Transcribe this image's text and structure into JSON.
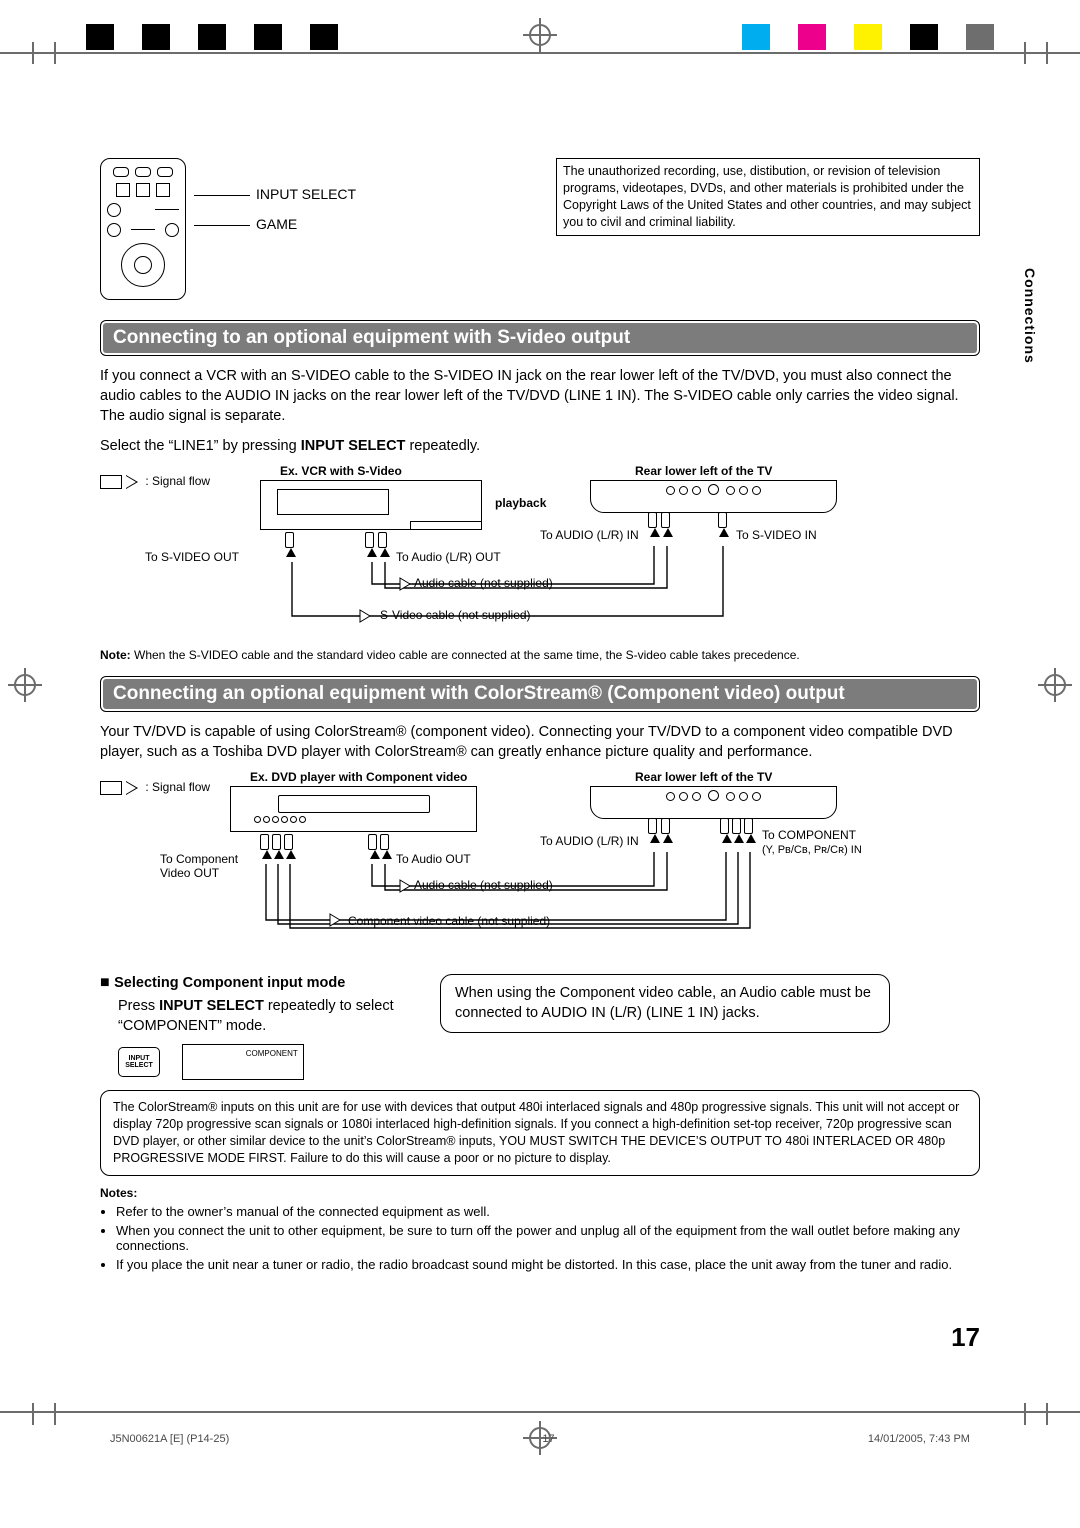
{
  "side_tab": "Connections",
  "remote": {
    "label_input": "INPUT SELECT",
    "label_game": "GAME"
  },
  "copyright_notice": "The unauthorized recording, use, distibution, or revision of television programs, videotapes, DVDs, and other materials is prohibited under the Copyright Laws of the United States and other countries, and may subject you to civil and criminal liability.",
  "section1": {
    "title": "Connecting to an optional equipment with S-video output",
    "body": "If you connect a VCR with an S-VIDEO cable to the S-VIDEO IN jack on the rear lower left of the TV/DVD, you must also connect the audio cables to the AUDIO IN jacks on the rear lower left of the TV/DVD (LINE 1 IN). The S-VIDEO cable only carries the video signal. The audio signal is separate.",
    "select_line": "Select the “LINE1” by pressing ",
    "select_bold": "INPUT SELECT",
    "select_tail": " repeatedly.",
    "signal_flow_label": ": Signal flow",
    "ex_label": "Ex.  VCR with S-Video",
    "playback": "playback",
    "rear_label": "Rear lower left of the TV",
    "to_svideo_out": "To S-VIDEO OUT",
    "to_audio_out": "To Audio (L/R) OUT",
    "to_audio_in": "To AUDIO (L/R) IN",
    "to_svideo_in": "To S-VIDEO IN",
    "audio_cable": "Audio cable (not supplied)",
    "svideo_cable": "S-Video cable (not supplied)",
    "note_bold": "Note:",
    "note": " When the S-VIDEO cable and the standard video cable are connected at the same time, the S-video cable takes precedence."
  },
  "section2": {
    "title": "Connecting an optional equipment with ColorStream® (Component video) output",
    "body": "Your TV/DVD is capable of using ColorStream® (component video). Connecting your TV/DVD to a component video compatible DVD player, such as a Toshiba DVD player with ColorStream® can greatly enhance picture quality and performance.",
    "signal_flow_label": ": Signal flow",
    "ex_label": "Ex. DVD player with Component video",
    "rear_label": "Rear lower left of the TV",
    "to_component_out1": "To Component",
    "to_component_out2": "Video OUT",
    "to_audio_out": "To Audio OUT",
    "to_audio_in": "To AUDIO (L/R) IN",
    "to_comp_in1": "To COMPONENT",
    "to_comp_in2": "(Y, Pʙ/Cʙ, Pʀ/Cʀ) IN",
    "audio_cable": "Audio cable (not supplied)",
    "component_cable": "Component video cable (not supplied)"
  },
  "selecting": {
    "bullet_title": "Selecting Component input mode",
    "line1a": "Press ",
    "line1b": "INPUT SELECT",
    "line1c": " repeatedly to select “COMPONENT” mode.",
    "btn_line1": "INPUT",
    "btn_line2": "SELECT",
    "osd_text": "COMPONENT"
  },
  "tip": "When using the Component video cable, an Audio cable must be connected to AUDIO IN (L/R) (LINE 1 IN) jacks.",
  "colorstream_note": "The ColorStream® inputs on this unit are for use with devices that output 480i interlaced signals and 480p progressive signals. This unit will not accept or display 720p progressive scan signals or 1080i interlaced high-definition signals. If you connect a high-definition set-top receiver, 720p progressive scan DVD player, or other similar device to the unit’s ColorStream® inputs, YOU MUST SWITCH THE DEVICE’S OUTPUT TO 480i INTERLACED OR 480p PROGRESSIVE MODE FIRST. Failure to do this will cause a poor or no picture to display.",
  "notes": {
    "header": "Notes:",
    "items": [
      "Refer to the owner’s manual of the connected equipment as well.",
      "When you connect the unit to other equipment, be sure to turn off the power and unplug all of the equipment from the wall outlet before making any connections.",
      "If you place the unit near a tuner or radio, the radio broadcast sound might be distorted. In this case, place the unit away from the tuner and radio."
    ]
  },
  "page_number": "17",
  "footer": {
    "doc_id": "J5N00621A [E] (P14-25)",
    "page": "17",
    "timestamp": "14/01/2005, 7:43 PM"
  }
}
